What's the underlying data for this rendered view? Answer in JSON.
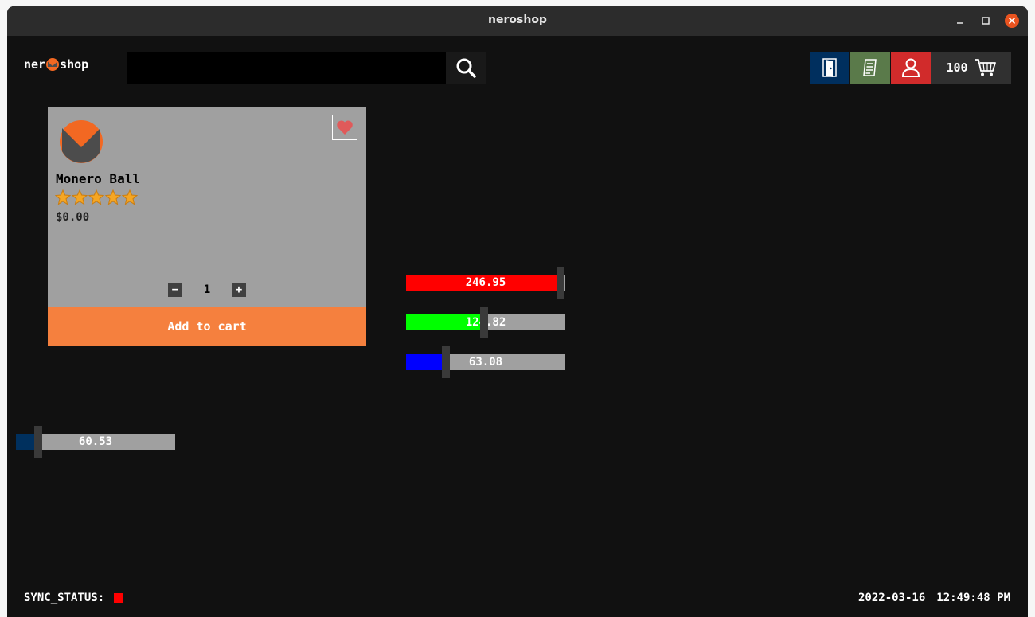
{
  "window": {
    "title": "neroshop"
  },
  "header": {
    "logo_left": "ner",
    "logo_right": "shop",
    "search": {
      "value": "",
      "placeholder": ""
    },
    "icons": {
      "search": "search-icon",
      "login": "door-icon",
      "orders": "receipt-icon",
      "account": "user-icon",
      "cart": "cart-icon"
    },
    "cart_count": "100"
  },
  "product": {
    "name": "Monero Ball",
    "rating": 5,
    "price": "$0.00",
    "quantity": "1",
    "minus_label": "−",
    "plus_label": "+",
    "add_to_cart_label": "Add to cart"
  },
  "sliders": [
    {
      "value": "246.95",
      "fraction": 0.97,
      "color": "#ff0000"
    },
    {
      "value": "124.82",
      "fraction": 0.49,
      "color": "#00ff00"
    },
    {
      "value": "63.08",
      "fraction": 0.25,
      "color": "#0000ff"
    },
    {
      "value": "60.53",
      "fraction": 0.14,
      "color": "#00305e"
    }
  ],
  "status": {
    "label": "SYNC_STATUS:",
    "color": "#ff0000"
  },
  "footer": {
    "date": "2022-03-16",
    "time": "12:49:48 PM"
  },
  "colors": {
    "background": "#111111",
    "card": "#a0a0a0",
    "accent": "#f5803e"
  }
}
